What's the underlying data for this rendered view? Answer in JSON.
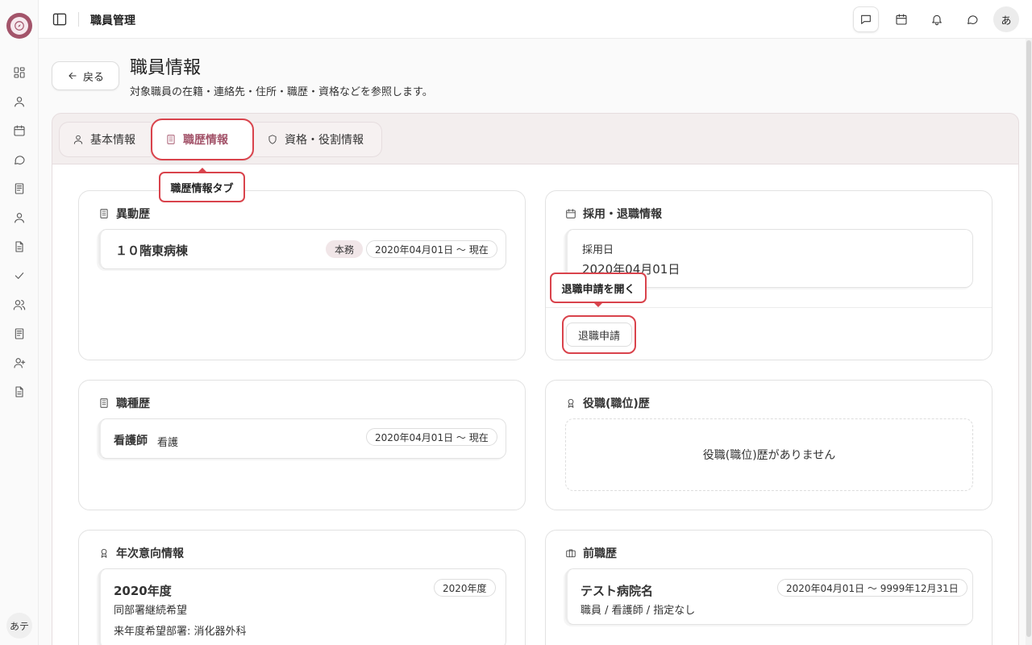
{
  "rail": {
    "icons": [
      "compass-icon",
      "grid-icon",
      "user-icon",
      "calendar-icon",
      "chat-icon",
      "book-icon",
      "user-icon",
      "document-icon",
      "check-icon",
      "users-icon",
      "book-icon",
      "user-plus-icon",
      "document-icon"
    ],
    "avatar": "あテ"
  },
  "topbar": {
    "title": "職員管理",
    "avatar": "あ"
  },
  "header": {
    "back_label": "戻る",
    "title": "職員情報",
    "subtitle": "対象職員の在籍・連絡先・住所・職歴・資格などを参照します。"
  },
  "tabs": {
    "basic": "基本情報",
    "career": "職歴情報",
    "qualification": "資格・役割情報"
  },
  "callouts": {
    "career_tab": "職歴情報タブ",
    "retire_open": "退職申請を開く"
  },
  "transfer": {
    "heading": "異動歴",
    "items": [
      {
        "name": "１０階東病棟",
        "badge": "本務",
        "period": "2020年04月01日 〜 現在"
      }
    ]
  },
  "hire": {
    "heading": "採用・退職情報",
    "hire_label": "採用日",
    "hire_date": "2020年04月01日",
    "retire_button": "退職申請"
  },
  "occupation": {
    "heading": "職種歴",
    "items": [
      {
        "name": "看護師",
        "sub": "看護",
        "period": "2020年04月01日 〜 現在"
      }
    ]
  },
  "position": {
    "heading": "役職(職位)歴",
    "empty": "役職(職位)歴がありません"
  },
  "annual": {
    "heading": "年次意向情報",
    "items": [
      {
        "year": "2020年度",
        "badge": "2020年度",
        "wish": "同部署継続希望",
        "next": "来年度希望部署: 消化器外科"
      }
    ]
  },
  "previous": {
    "heading": "前職歴",
    "items": [
      {
        "name": "テスト病院名",
        "period": "2020年04月01日 〜 9999年12月31日",
        "detail": "職員 / 看護師 / 指定なし"
      }
    ]
  },
  "colors": {
    "accent": "#a3546a",
    "highlight": "#d9434c"
  }
}
